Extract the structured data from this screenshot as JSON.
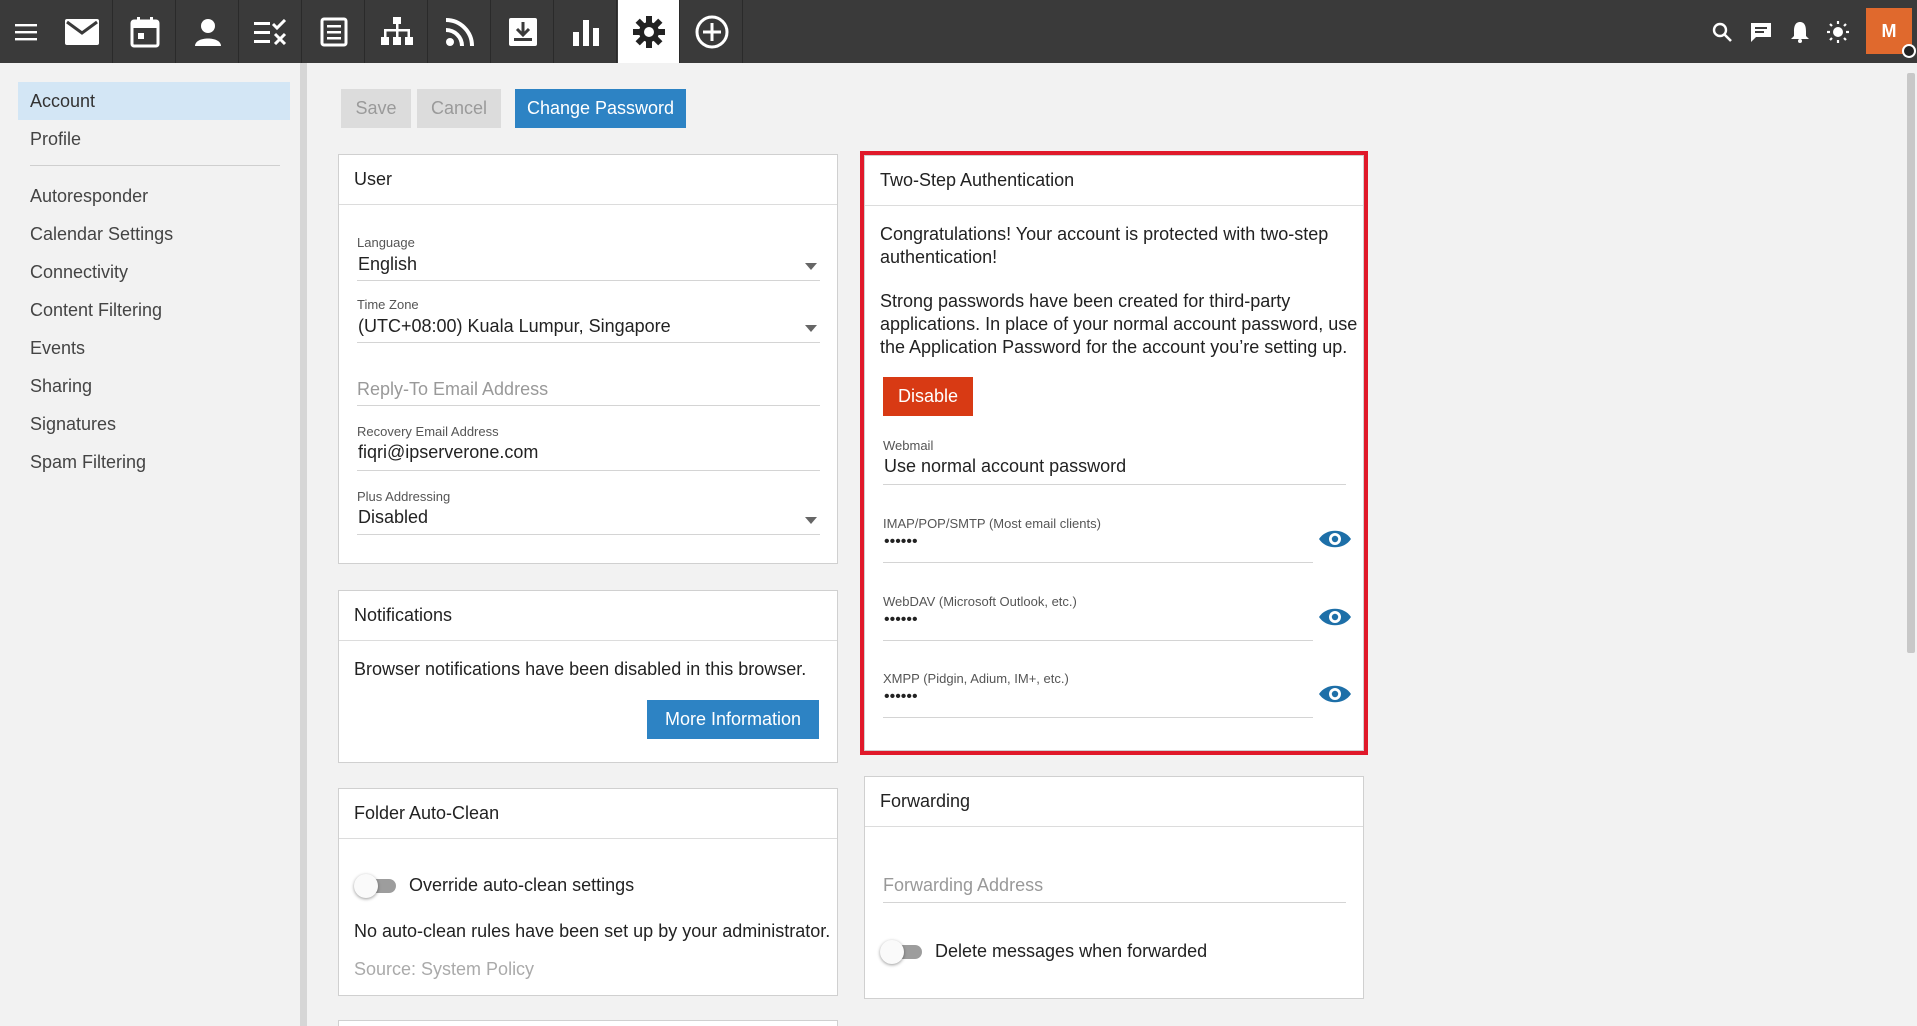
{
  "topbar": {
    "nav_icons": [
      "mail-icon",
      "calendar-icon",
      "contacts-icon",
      "tasks-icon",
      "notes-icon",
      "sitemap-icon",
      "rss-icon",
      "download-icon",
      "chart-icon",
      "settings-icon",
      "add-icon"
    ],
    "active": "settings-icon",
    "right_icons": [
      "search-icon",
      "chat-icon",
      "bell-icon",
      "sun-icon"
    ],
    "avatar": "M",
    "colors": {
      "bar": "#3a3a3a",
      "avatar": "#e0692d"
    }
  },
  "sidebar": {
    "top_items": [
      "Account",
      "Profile"
    ],
    "items": [
      "Autoresponder",
      "Calendar Settings",
      "Connectivity",
      "Content Filtering",
      "Events",
      "Sharing",
      "Signatures",
      "Spam Filtering"
    ]
  },
  "toolbar": {
    "save": "Save",
    "cancel": "Cancel",
    "change_password": "Change Password"
  },
  "user": {
    "title": "User",
    "language_label": "Language",
    "language_value": "English",
    "timezone_label": "Time Zone",
    "timezone_value": "(UTC+08:00) Kuala Lumpur, Singapore",
    "reply_to_placeholder": "Reply-To Email Address",
    "recovery_label": "Recovery Email Address",
    "recovery_value": "fiqri@ipserverone.com",
    "plus_label": "Plus Addressing",
    "plus_value": "Disabled"
  },
  "notifications": {
    "title": "Notifications",
    "text": "Browser notifications have been disabled in this browser.",
    "more_info": "More Information"
  },
  "autoclean": {
    "title": "Folder Auto-Clean",
    "override_label": "Override auto-clean settings",
    "override_on": false,
    "text": "No auto-clean rules have been set up by your administrator.",
    "source": "Source: System Policy"
  },
  "twostep": {
    "title": "Two-Step Authentication",
    "congrats": "Congratulations! Your account is protected with two-step authentication!",
    "strong": "Strong passwords have been created for third-party applications. In place of your normal account password, use the Application Password for the account you’re setting up.",
    "disable": "Disable",
    "webmail_label": "Webmail",
    "webmail_value": "Use normal account password",
    "imap_label": "IMAP/POP/SMTP (Most email clients)",
    "imap_value": "••••••",
    "webdav_label": "WebDAV (Microsoft Outlook, etc.)",
    "webdav_value": "••••••",
    "xmpp_label": "XMPP (Pidgin, Adium, IM+, etc.)",
    "xmpp_value": "••••••",
    "highlight_color": "#e0192a"
  },
  "forwarding": {
    "title": "Forwarding",
    "address_placeholder": "Forwarding Address",
    "delete_label": "Delete messages when forwarded",
    "delete_on": false
  }
}
